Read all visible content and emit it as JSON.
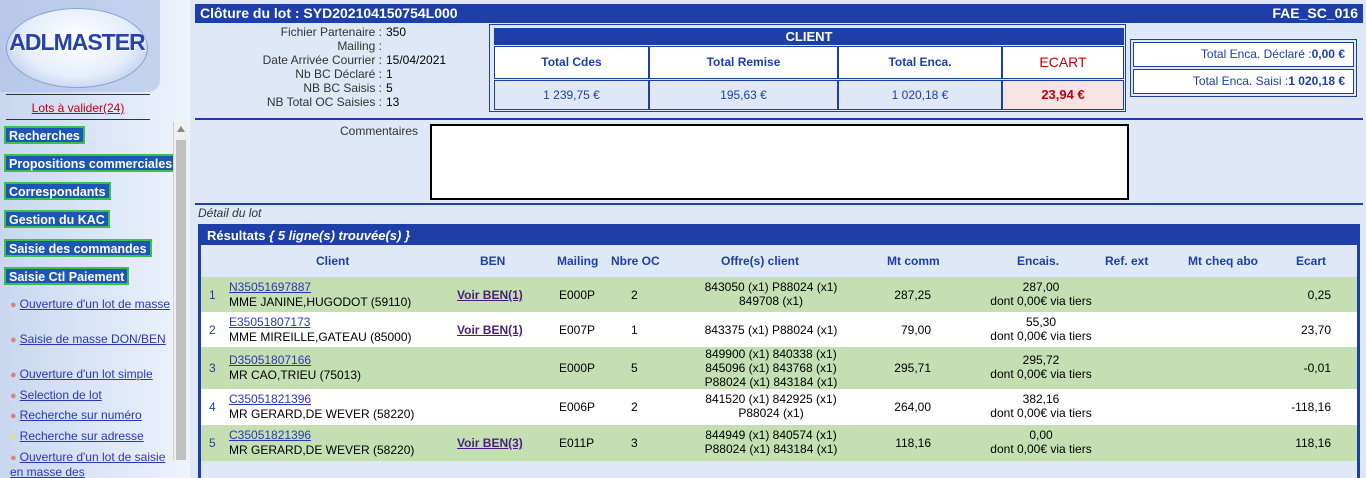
{
  "sidebar": {
    "logo_text": "ADLMASTER",
    "lots_link": "Lots à valider(24)",
    "menu": [
      {
        "label": "Recherches"
      },
      {
        "label": "Propositions commerciales"
      },
      {
        "label": "Correspondants"
      },
      {
        "label": "Gestion du KAC"
      },
      {
        "label": "Saisie des commandes"
      },
      {
        "label": "Saisie Ctl Paiement"
      }
    ],
    "sub_items": [
      {
        "label": "Ouverture d'un lot de masse"
      },
      {
        "label": "Saisie de masse DON/BEN"
      },
      {
        "label": "Ouverture d'un lot simple"
      },
      {
        "label": "Selection de lot"
      },
      {
        "label": "Recherche sur numéro"
      },
      {
        "label": "Recherche sur adresse"
      },
      {
        "label": "Ouverture d'un lot de saisie en masse des"
      }
    ]
  },
  "header": {
    "title": "Clôture du lot : SYD202104150754L000",
    "screen_code": "FAE_SC_016"
  },
  "info": [
    {
      "label": "Fichier Partenaire :",
      "value": "350"
    },
    {
      "label": "Mailing :",
      "value": ""
    },
    {
      "label": "Date Arrivée Courrier :",
      "value": "15/04/2021"
    },
    {
      "label": "Nb BC Déclaré :",
      "value": "1"
    },
    {
      "label": "NB BC Saisis :",
      "value": "5"
    },
    {
      "label": "NB Total OC Saisies :",
      "value": "13"
    }
  ],
  "client": {
    "title": "CLIENT",
    "headers": [
      "Total Cdes",
      "Total Remise",
      "Total Enca.",
      "ECART"
    ],
    "values": [
      "1 239,75 €",
      "195,63 €",
      "1 020,18 €",
      "23,94 €"
    ]
  },
  "encaissement": {
    "declared_label": "Total Enca. Déclaré :",
    "declared_value": "0,00 €",
    "saisi_label": "Total Enca. Saisi :",
    "saisi_value": "1 020,18 €"
  },
  "comment": {
    "label": "Commentaires",
    "value": ""
  },
  "detail_label": "Détail du lot",
  "results": {
    "title": "Résultats",
    "count_text": "{ 5 ligne(s) trouvée(s) }",
    "columns": [
      "Client",
      "BEN",
      "Mailing",
      "Nbre OC",
      "Offre(s) client",
      "Mt comm",
      "Encais.",
      "Ref. ext",
      "Mt cheq abo",
      "Ecart"
    ],
    "rows": [
      {
        "n": "1",
        "client_id": "N35051697887",
        "client_name": "MME JANINE,HUGODOT (59110)",
        "ben": "Voir BEN(1)",
        "mailing": "E000P",
        "nbre_oc": "2",
        "offres": [
          "843050 (x1)   P88024 (x1)",
          "849708 (x1)"
        ],
        "mt_comm": "287,25",
        "encais": "287,00",
        "encais_sub": "dont 0,00€ via tiers",
        "ecart": "0,25"
      },
      {
        "n": "2",
        "client_id": "E35051807173",
        "client_name": "MME MIREILLE,GATEAU (85000)",
        "ben": "Voir BEN(1)",
        "mailing": "E007P",
        "nbre_oc": "1",
        "offres": [
          "843375 (x1)   P88024 (x1)"
        ],
        "mt_comm": "79,00",
        "encais": "55,30",
        "encais_sub": "dont 0,00€ via tiers",
        "ecart": "23,70"
      },
      {
        "n": "3",
        "client_id": "D35051807166",
        "client_name": "MR CAO,TRIEU (75013)",
        "ben": "",
        "mailing": "E000P",
        "nbre_oc": "5",
        "offres": [
          "849900 (x1)   840338 (x1)",
          "845096 (x1)   843768 (x1)",
          "P88024 (x1)   843184 (x1)"
        ],
        "mt_comm": "295,71",
        "encais": "295,72",
        "encais_sub": "dont 0,00€ via tiers",
        "ecart": "-0,01"
      },
      {
        "n": "4",
        "client_id": "C35051821396",
        "client_name": "MR GERARD,DE WEVER (58220)",
        "ben": "",
        "mailing": "E006P",
        "nbre_oc": "2",
        "offres": [
          "841520 (x1)   842925 (x1)",
          "P88024 (x1)"
        ],
        "mt_comm": "264,00",
        "encais": "382,16",
        "encais_sub": "dont 0,00€ via tiers",
        "ecart": "-118,16"
      },
      {
        "n": "5",
        "client_id": "C35051821396",
        "client_name": "MR GERARD,DE WEVER (58220)",
        "ben": "Voir BEN(3)",
        "mailing": "E011P",
        "nbre_oc": "3",
        "offres": [
          "844949 (x1)   840574 (x1)",
          "P88024 (x1)   843184 (x1)"
        ],
        "mt_comm": "118,16",
        "encais": "0,00",
        "encais_sub": "dont 0,00€ via tiers",
        "ecart": "118,16"
      }
    ]
  }
}
